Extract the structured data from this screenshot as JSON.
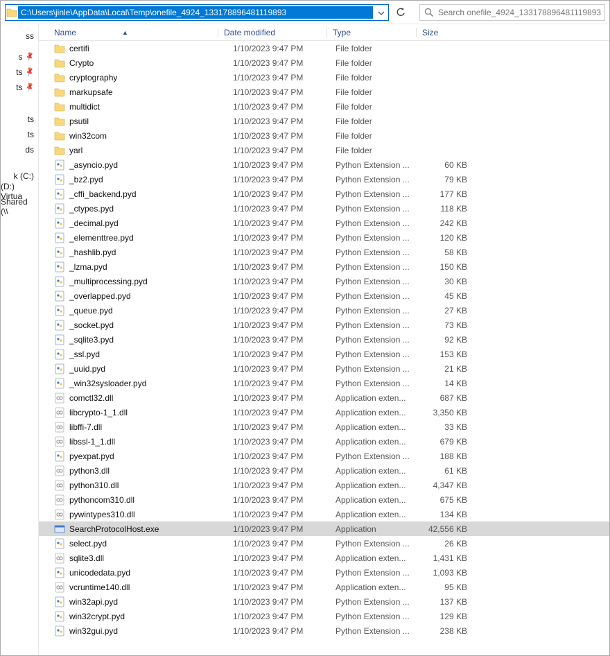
{
  "address": {
    "path": "C:\\Users\\jinle\\AppData\\Local\\Temp\\onefile_4924_133178896481119893"
  },
  "search": {
    "placeholder": "Search onefile_4924_133178896481119893"
  },
  "nav": {
    "items": [
      "ss",
      "",
      "s",
      "ts",
      "ts",
      "",
      "",
      "",
      "ts",
      "ts",
      "ds",
      "",
      "",
      "k (C:)",
      "(D:) Virtua",
      "Shared (\\\\"
    ]
  },
  "columns": {
    "name": "Name",
    "date": "Date modified",
    "type": "Type",
    "size": "Size"
  },
  "types": {
    "folder": "File folder",
    "pyd": "Python Extension ...",
    "dll": "Application exten...",
    "exe": "Application"
  },
  "files": [
    {
      "icon": "folder",
      "name": "certifi",
      "date": "1/10/2023 9:47 PM",
      "typeKey": "folder",
      "size": ""
    },
    {
      "icon": "folder",
      "name": "Crypto",
      "date": "1/10/2023 9:47 PM",
      "typeKey": "folder",
      "size": ""
    },
    {
      "icon": "folder",
      "name": "cryptography",
      "date": "1/10/2023 9:47 PM",
      "typeKey": "folder",
      "size": ""
    },
    {
      "icon": "folder",
      "name": "markupsafe",
      "date": "1/10/2023 9:47 PM",
      "typeKey": "folder",
      "size": ""
    },
    {
      "icon": "folder",
      "name": "multidict",
      "date": "1/10/2023 9:47 PM",
      "typeKey": "folder",
      "size": ""
    },
    {
      "icon": "folder",
      "name": "psutil",
      "date": "1/10/2023 9:47 PM",
      "typeKey": "folder",
      "size": ""
    },
    {
      "icon": "folder",
      "name": "win32com",
      "date": "1/10/2023 9:47 PM",
      "typeKey": "folder",
      "size": ""
    },
    {
      "icon": "folder",
      "name": "yarl",
      "date": "1/10/2023 9:47 PM",
      "typeKey": "folder",
      "size": ""
    },
    {
      "icon": "pyd",
      "name": "_asyncio.pyd",
      "date": "1/10/2023 9:47 PM",
      "typeKey": "pyd",
      "size": "60 KB"
    },
    {
      "icon": "pyd",
      "name": "_bz2.pyd",
      "date": "1/10/2023 9:47 PM",
      "typeKey": "pyd",
      "size": "79 KB"
    },
    {
      "icon": "pyd",
      "name": "_cffi_backend.pyd",
      "date": "1/10/2023 9:47 PM",
      "typeKey": "pyd",
      "size": "177 KB"
    },
    {
      "icon": "pyd",
      "name": "_ctypes.pyd",
      "date": "1/10/2023 9:47 PM",
      "typeKey": "pyd",
      "size": "118 KB"
    },
    {
      "icon": "pyd",
      "name": "_decimal.pyd",
      "date": "1/10/2023 9:47 PM",
      "typeKey": "pyd",
      "size": "242 KB"
    },
    {
      "icon": "pyd",
      "name": "_elementtree.pyd",
      "date": "1/10/2023 9:47 PM",
      "typeKey": "pyd",
      "size": "120 KB"
    },
    {
      "icon": "pyd",
      "name": "_hashlib.pyd",
      "date": "1/10/2023 9:47 PM",
      "typeKey": "pyd",
      "size": "58 KB"
    },
    {
      "icon": "pyd",
      "name": "_lzma.pyd",
      "date": "1/10/2023 9:47 PM",
      "typeKey": "pyd",
      "size": "150 KB"
    },
    {
      "icon": "pyd",
      "name": "_multiprocessing.pyd",
      "date": "1/10/2023 9:47 PM",
      "typeKey": "pyd",
      "size": "30 KB"
    },
    {
      "icon": "pyd",
      "name": "_overlapped.pyd",
      "date": "1/10/2023 9:47 PM",
      "typeKey": "pyd",
      "size": "45 KB"
    },
    {
      "icon": "pyd",
      "name": "_queue.pyd",
      "date": "1/10/2023 9:47 PM",
      "typeKey": "pyd",
      "size": "27 KB"
    },
    {
      "icon": "pyd",
      "name": "_socket.pyd",
      "date": "1/10/2023 9:47 PM",
      "typeKey": "pyd",
      "size": "73 KB"
    },
    {
      "icon": "pyd",
      "name": "_sqlite3.pyd",
      "date": "1/10/2023 9:47 PM",
      "typeKey": "pyd",
      "size": "92 KB"
    },
    {
      "icon": "pyd",
      "name": "_ssl.pyd",
      "date": "1/10/2023 9:47 PM",
      "typeKey": "pyd",
      "size": "153 KB"
    },
    {
      "icon": "pyd",
      "name": "_uuid.pyd",
      "date": "1/10/2023 9:47 PM",
      "typeKey": "pyd",
      "size": "21 KB"
    },
    {
      "icon": "pyd",
      "name": "_win32sysloader.pyd",
      "date": "1/10/2023 9:47 PM",
      "typeKey": "pyd",
      "size": "14 KB"
    },
    {
      "icon": "dll",
      "name": "comctl32.dll",
      "date": "1/10/2023 9:47 PM",
      "typeKey": "dll",
      "size": "687 KB"
    },
    {
      "icon": "dll",
      "name": "libcrypto-1_1.dll",
      "date": "1/10/2023 9:47 PM",
      "typeKey": "dll",
      "size": "3,350 KB"
    },
    {
      "icon": "dll",
      "name": "libffi-7.dll",
      "date": "1/10/2023 9:47 PM",
      "typeKey": "dll",
      "size": "33 KB"
    },
    {
      "icon": "dll",
      "name": "libssl-1_1.dll",
      "date": "1/10/2023 9:47 PM",
      "typeKey": "dll",
      "size": "679 KB"
    },
    {
      "icon": "pyd",
      "name": "pyexpat.pyd",
      "date": "1/10/2023 9:47 PM",
      "typeKey": "pyd",
      "size": "188 KB"
    },
    {
      "icon": "dll",
      "name": "python3.dll",
      "date": "1/10/2023 9:47 PM",
      "typeKey": "dll",
      "size": "61 KB"
    },
    {
      "icon": "dll",
      "name": "python310.dll",
      "date": "1/10/2023 9:47 PM",
      "typeKey": "dll",
      "size": "4,347 KB"
    },
    {
      "icon": "dll",
      "name": "pythoncom310.dll",
      "date": "1/10/2023 9:47 PM",
      "typeKey": "dll",
      "size": "675 KB"
    },
    {
      "icon": "dll",
      "name": "pywintypes310.dll",
      "date": "1/10/2023 9:47 PM",
      "typeKey": "dll",
      "size": "134 KB"
    },
    {
      "icon": "exe",
      "name": "SearchProtocolHost.exe",
      "date": "1/10/2023 9:47 PM",
      "typeKey": "exe",
      "size": "42,556 KB",
      "selected": true
    },
    {
      "icon": "pyd",
      "name": "select.pyd",
      "date": "1/10/2023 9:47 PM",
      "typeKey": "pyd",
      "size": "26 KB"
    },
    {
      "icon": "dll",
      "name": "sqlite3.dll",
      "date": "1/10/2023 9:47 PM",
      "typeKey": "dll",
      "size": "1,431 KB"
    },
    {
      "icon": "pyd",
      "name": "unicodedata.pyd",
      "date": "1/10/2023 9:47 PM",
      "typeKey": "pyd",
      "size": "1,093 KB"
    },
    {
      "icon": "dll",
      "name": "vcruntime140.dll",
      "date": "1/10/2023 9:47 PM",
      "typeKey": "dll",
      "size": "95 KB"
    },
    {
      "icon": "pyd",
      "name": "win32api.pyd",
      "date": "1/10/2023 9:47 PM",
      "typeKey": "pyd",
      "size": "137 KB"
    },
    {
      "icon": "pyd",
      "name": "win32crypt.pyd",
      "date": "1/10/2023 9:47 PM",
      "typeKey": "pyd",
      "size": "129 KB"
    },
    {
      "icon": "pyd",
      "name": "win32gui.pyd",
      "date": "1/10/2023 9:47 PM",
      "typeKey": "pyd",
      "size": "238 KB"
    }
  ]
}
